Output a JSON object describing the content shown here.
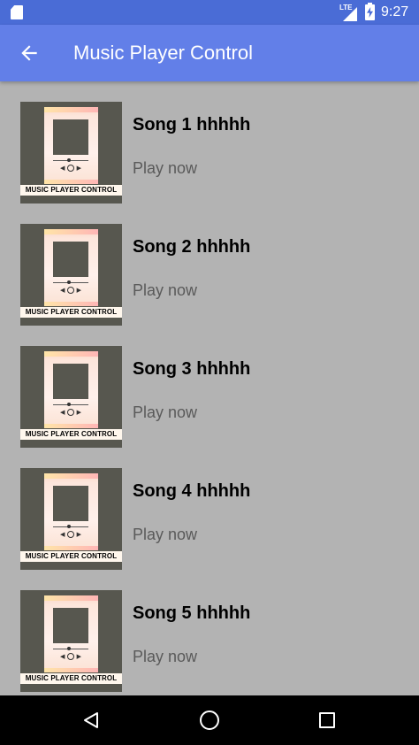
{
  "status_bar": {
    "network": "LTE",
    "time": "9:27"
  },
  "app_bar": {
    "title": "Music Player Control",
    "back_icon": "arrow-back-icon"
  },
  "songs": [
    {
      "title": "Song 1 hhhhh",
      "action": "Play now",
      "thumb_caption": "MUSIC PLAYER CONTROL"
    },
    {
      "title": "Song 2 hhhhh",
      "action": "Play now",
      "thumb_caption": "MUSIC PLAYER CONTROL"
    },
    {
      "title": "Song 3 hhhhh",
      "action": "Play now",
      "thumb_caption": "MUSIC PLAYER CONTROL"
    },
    {
      "title": "Song 4 hhhhh",
      "action": "Play now",
      "thumb_caption": "MUSIC PLAYER CONTROL"
    },
    {
      "title": "Song 5 hhhhh",
      "action": "Play now",
      "thumb_caption": "MUSIC PLAYER CONTROL"
    }
  ],
  "nav_bar": {
    "icons": [
      "back-triangle-icon",
      "home-circle-icon",
      "recents-square-icon"
    ]
  },
  "colors": {
    "status_bar": "#4a6cd6",
    "app_bar": "#627fe8",
    "background": "#b3b3b3"
  }
}
